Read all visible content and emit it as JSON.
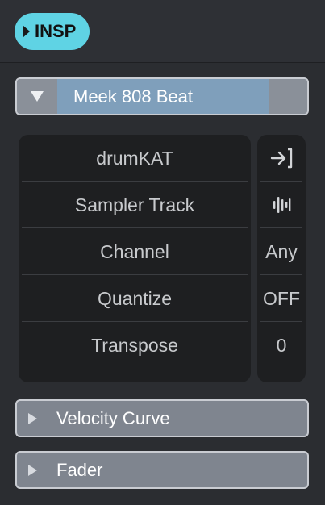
{
  "header": {
    "insp_label": "INSP"
  },
  "track": {
    "name": "Meek 808 Beat"
  },
  "rows": [
    {
      "label": "drumKAT",
      "value_icon": "input-arrow-icon"
    },
    {
      "label": "Sampler Track",
      "value_icon": "waveform-bars-icon"
    },
    {
      "label": "Channel",
      "value": "Any"
    },
    {
      "label": "Quantize",
      "value": "OFF"
    },
    {
      "label": "Transpose",
      "value": "0"
    }
  ],
  "sections": [
    {
      "label": "Velocity Curve"
    },
    {
      "label": "Fader"
    }
  ]
}
